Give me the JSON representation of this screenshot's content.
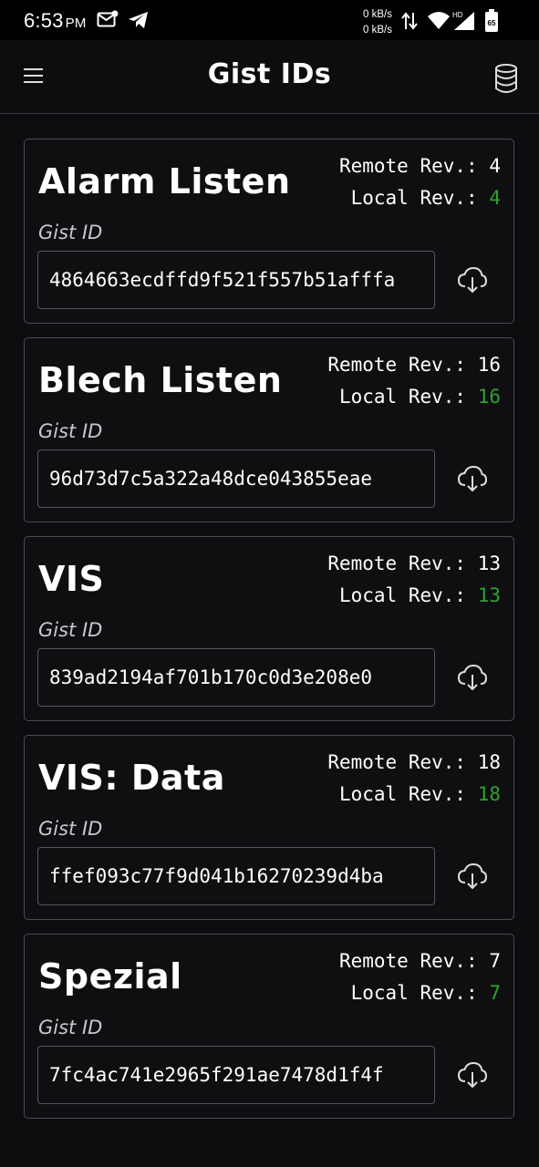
{
  "status_bar": {
    "time": "6:53",
    "ampm": "PM",
    "speed_up": "0 kB/s",
    "speed_down": "0 kB/s",
    "network": "HD",
    "battery": "65"
  },
  "app_bar": {
    "title": "Gist IDs",
    "menu_icon": "hamburger-menu-icon",
    "db_icon": "database-icon"
  },
  "labels": {
    "remote": "Remote Rev.:",
    "local": "Local Rev.:",
    "gist_id": "Gist ID"
  },
  "colors": {
    "local_rev": "#2fa12f",
    "background": "#0d0d0f",
    "card_border": "#4a4a55"
  },
  "gists": [
    {
      "name": "Alarm Listen",
      "remote_rev": "4",
      "local_rev": "4",
      "gist_id": "4864663ecdffd9f521f557b51afffa"
    },
    {
      "name": "Blech Listen",
      "remote_rev": "16",
      "local_rev": "16",
      "gist_id": "96d73d7c5a322a48dce043855eae"
    },
    {
      "name": "VIS",
      "remote_rev": "13",
      "local_rev": "13",
      "gist_id": "839ad2194af701b170c0d3e208e0"
    },
    {
      "name": "VIS: Data",
      "remote_rev": "18",
      "local_rev": "18",
      "gist_id": "ffef093c77f9d041b16270239d4ba"
    },
    {
      "name": "Spezial",
      "remote_rev": "7",
      "local_rev": "7",
      "gist_id": "7fc4ac741e2965f291ae7478d1f4f"
    }
  ]
}
